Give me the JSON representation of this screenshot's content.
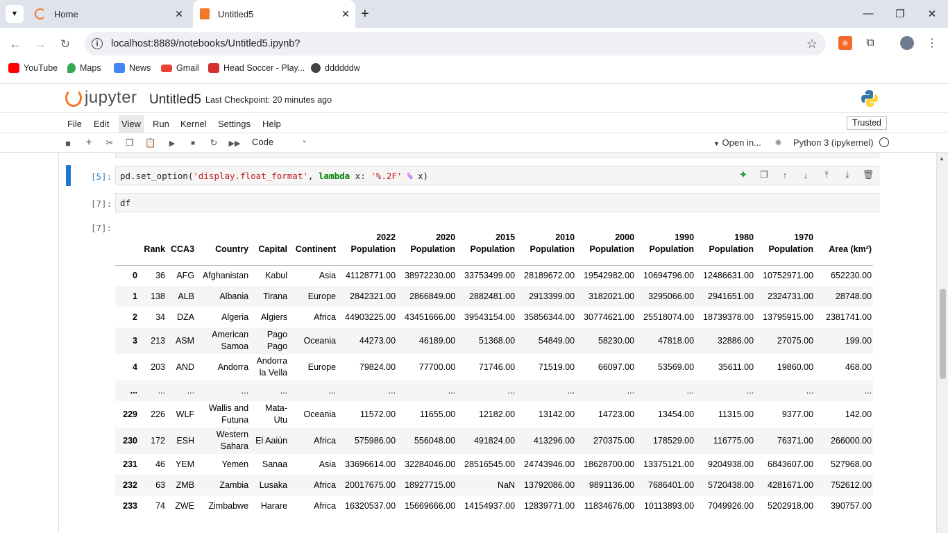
{
  "browser": {
    "tabs": [
      {
        "title": "Home",
        "icon": "jupyter-tab-icon"
      },
      {
        "title": "Untitled5",
        "icon": "notebook-tab-icon"
      }
    ],
    "url": "localhost:8889/notebooks/Untitled5.ipynb?",
    "bookmarks": [
      {
        "label": "YouTube",
        "color": "#ff0000"
      },
      {
        "label": "Maps",
        "color": "#34a853"
      },
      {
        "label": "News",
        "color": "#4285f4"
      },
      {
        "label": "Gmail",
        "color": "#ea4335"
      },
      {
        "label": "Head Soccer - Play...",
        "color": "#d32f2f"
      },
      {
        "label": "ddddddw",
        "color": "#444444"
      }
    ]
  },
  "jupyter": {
    "logo_text": "jupyter",
    "notebook_title": "Untitled5",
    "checkpoint": "Last Checkpoint: 20 minutes ago",
    "menu": [
      "File",
      "Edit",
      "View",
      "Run",
      "Kernel",
      "Settings",
      "Help"
    ],
    "active_menu": "View",
    "trusted": "Trusted",
    "cell_type": "Code",
    "open_in": "Open in...",
    "kernel": "Python 3 (ipykernel)"
  },
  "cells": {
    "c1_prompt": "[5]:",
    "c1_code": {
      "fn": "pd.set_option(",
      "arg1": "'display.float_format'",
      "sep": ", ",
      "kw": "lambda",
      "mid": " x: ",
      "fmt": "'%.2F'",
      "op": " % ",
      "end": "x)"
    },
    "c2_prompt": "[7]:",
    "c2_code": "df",
    "out_prompt": "[7]:"
  },
  "table": {
    "headers": [
      "",
      "Rank",
      "CCA3",
      "Country",
      "Capital",
      "Continent",
      "2022 Population",
      "2020 Population",
      "2015 Population",
      "2010 Population",
      "2000 Population",
      "1990 Population",
      "1980 Population",
      "1970 Population",
      "Area (km²)"
    ],
    "rows": [
      [
        "0",
        "36",
        "AFG",
        "Afghanistan",
        "Kabul",
        "Asia",
        "41128771.00",
        "38972230.00",
        "33753499.00",
        "28189672.00",
        "19542982.00",
        "10694796.00",
        "12486631.00",
        "10752971.00",
        "652230.00"
      ],
      [
        "1",
        "138",
        "ALB",
        "Albania",
        "Tirana",
        "Europe",
        "2842321.00",
        "2866849.00",
        "2882481.00",
        "2913399.00",
        "3182021.00",
        "3295066.00",
        "2941651.00",
        "2324731.00",
        "28748.00"
      ],
      [
        "2",
        "34",
        "DZA",
        "Algeria",
        "Algiers",
        "Africa",
        "44903225.00",
        "43451666.00",
        "39543154.00",
        "35856344.00",
        "30774621.00",
        "25518074.00",
        "18739378.00",
        "13795915.00",
        "2381741.00"
      ],
      [
        "3",
        "213",
        "ASM",
        "American Samoa",
        "Pago Pago",
        "Oceania",
        "44273.00",
        "46189.00",
        "51368.00",
        "54849.00",
        "58230.00",
        "47818.00",
        "32886.00",
        "27075.00",
        "199.00"
      ],
      [
        "4",
        "203",
        "AND",
        "Andorra",
        "Andorra la Vella",
        "Europe",
        "79824.00",
        "77700.00",
        "71746.00",
        "71519.00",
        "66097.00",
        "53569.00",
        "35611.00",
        "19860.00",
        "468.00"
      ],
      [
        "...",
        "...",
        "...",
        "...",
        "...",
        "...",
        "...",
        "...",
        "...",
        "...",
        "...",
        "...",
        "...",
        "...",
        "..."
      ],
      [
        "229",
        "226",
        "WLF",
        "Wallis and Futuna",
        "Mata-Utu",
        "Oceania",
        "11572.00",
        "11655.00",
        "12182.00",
        "13142.00",
        "14723.00",
        "13454.00",
        "11315.00",
        "9377.00",
        "142.00"
      ],
      [
        "230",
        "172",
        "ESH",
        "Western Sahara",
        "El Aaiún",
        "Africa",
        "575986.00",
        "556048.00",
        "491824.00",
        "413296.00",
        "270375.00",
        "178529.00",
        "116775.00",
        "76371.00",
        "266000.00"
      ],
      [
        "231",
        "46",
        "YEM",
        "Yemen",
        "Sanaa",
        "Asia",
        "33696614.00",
        "32284046.00",
        "28516545.00",
        "24743946.00",
        "18628700.00",
        "13375121.00",
        "9204938.00",
        "6843607.00",
        "527968.00"
      ],
      [
        "232",
        "63",
        "ZMB",
        "Zambia",
        "Lusaka",
        "Africa",
        "20017675.00",
        "18927715.00",
        "NaN",
        "13792086.00",
        "9891136.00",
        "7686401.00",
        "5720438.00",
        "4281671.00",
        "752612.00"
      ],
      [
        "233",
        "74",
        "ZWE",
        "Zimbabwe",
        "Harare",
        "Africa",
        "16320537.00",
        "15669666.00",
        "14154937.00",
        "12839771.00",
        "11834676.00",
        "10113893.00",
        "7049926.00",
        "5202918.00",
        "390757.00"
      ]
    ]
  }
}
